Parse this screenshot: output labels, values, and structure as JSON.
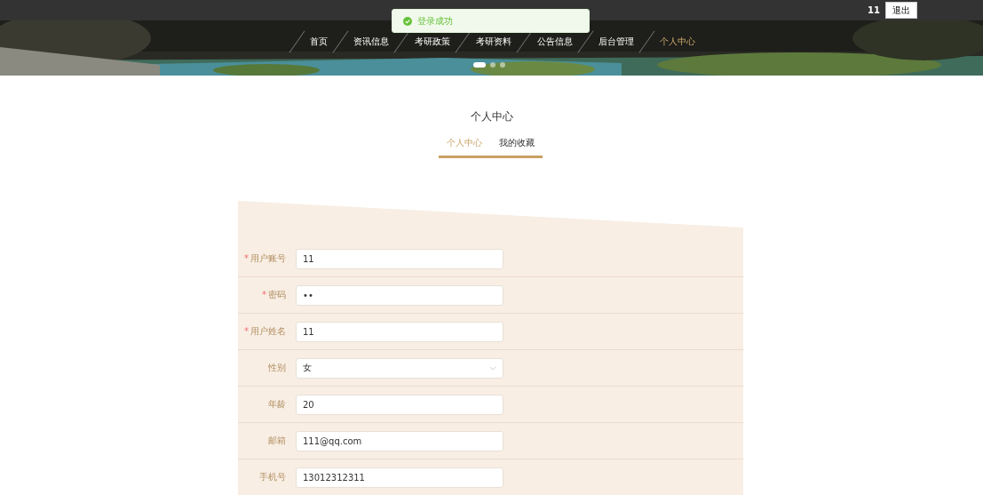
{
  "header": {
    "user": "11",
    "logout": "退出"
  },
  "toast": {
    "message": "登录成功"
  },
  "nav": [
    {
      "label": "首页",
      "selected": false
    },
    {
      "label": "资讯信息",
      "selected": false
    },
    {
      "label": "考研政策",
      "selected": false
    },
    {
      "label": "考研资料",
      "selected": false
    },
    {
      "label": "公告信息",
      "selected": false
    },
    {
      "label": "后台管理",
      "selected": false
    },
    {
      "label": "个人中心",
      "selected": true
    }
  ],
  "carousel_dots": [
    {
      "selected": true
    },
    {
      "selected": false
    },
    {
      "selected": false
    }
  ],
  "page_title": "个人中心",
  "tabs": [
    {
      "label": "个人中心",
      "selected": true
    },
    {
      "label": "我的收藏",
      "selected": false
    }
  ],
  "form": [
    {
      "label": "用户账号",
      "required_mark": "*",
      "kind": "text",
      "value": "11"
    },
    {
      "label": "密码",
      "required_mark": "*",
      "kind": "text",
      "value": "••"
    },
    {
      "label": "用户姓名",
      "required_mark": "*",
      "kind": "text",
      "value": "11"
    },
    {
      "label": "性别",
      "kind": "select",
      "value": "女"
    },
    {
      "label": "年龄",
      "kind": "text",
      "value": "20"
    },
    {
      "label": "邮箱",
      "kind": "text",
      "value": "111@qq.com"
    },
    {
      "label": "手机号",
      "kind": "text",
      "value": "13012312311"
    }
  ]
}
